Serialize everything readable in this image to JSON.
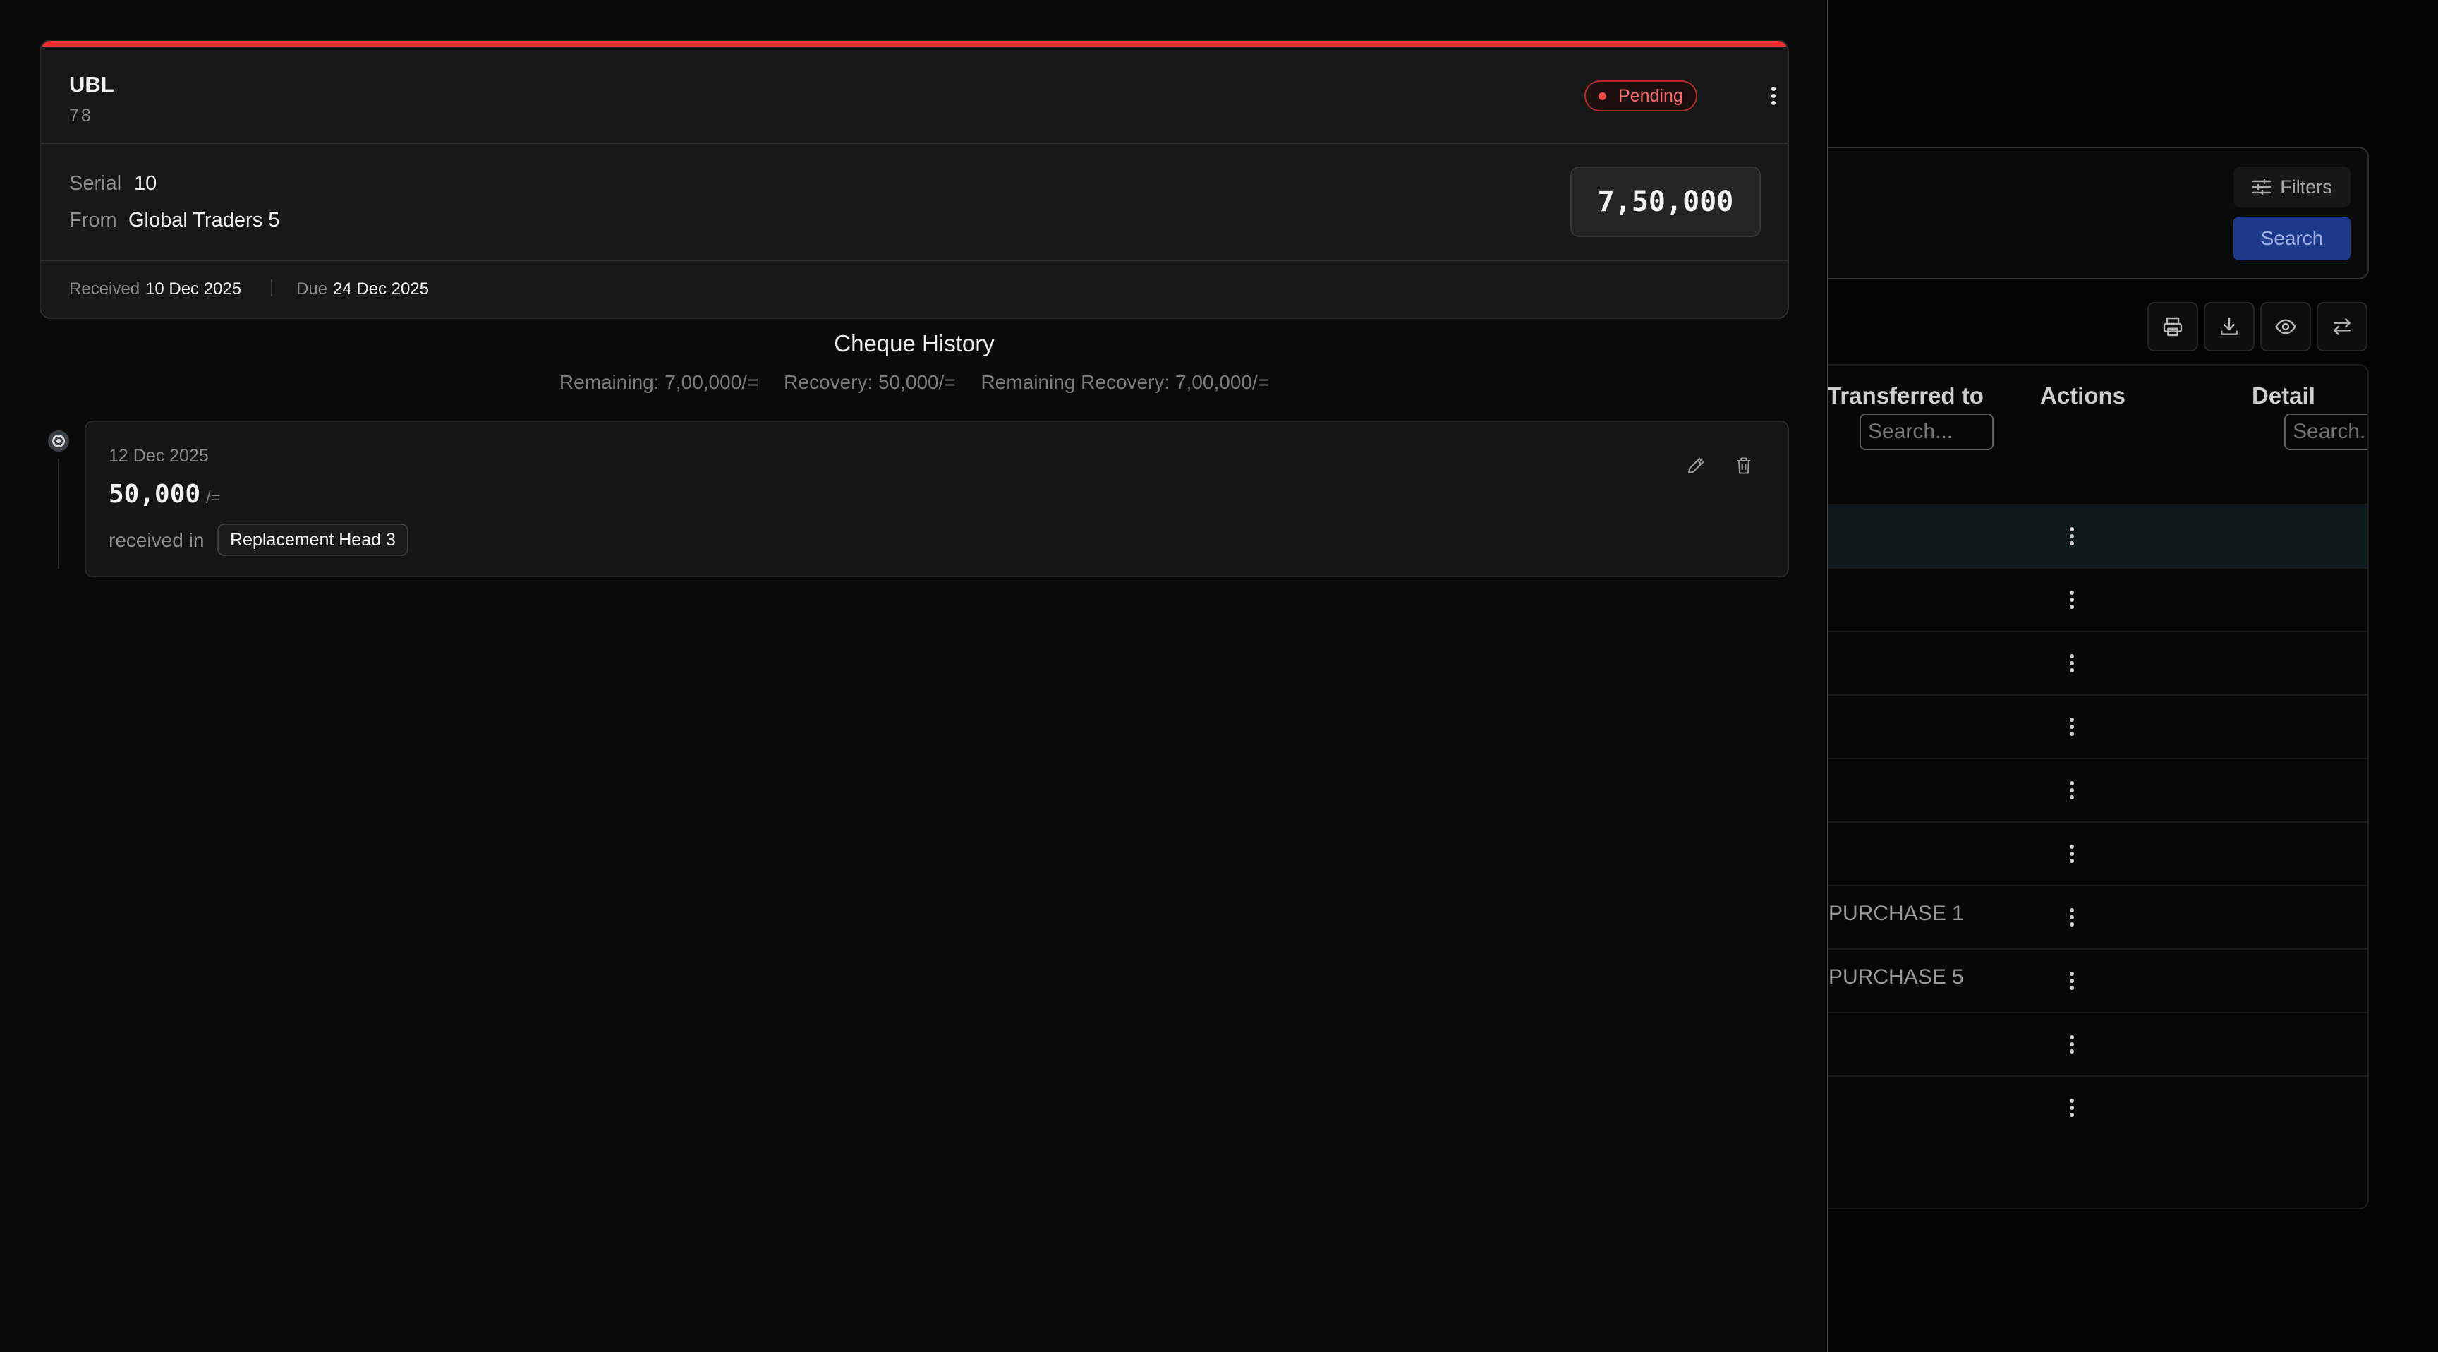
{
  "background": {
    "filters_label": "Filters",
    "search_button_label": "Search",
    "table": {
      "columns": [
        "Transferred to",
        "Actions",
        "Detail"
      ],
      "search_placeholder": "Search...",
      "rows": [
        {
          "transferred_to": ""
        },
        {
          "transferred_to": ""
        },
        {
          "transferred_to": ""
        },
        {
          "transferred_to": ""
        },
        {
          "transferred_to": ""
        },
        {
          "transferred_to": ""
        },
        {
          "transferred_to": "PURCHASE 1"
        },
        {
          "transferred_to": "PURCHASE 5"
        },
        {
          "transferred_to": ""
        },
        {
          "transferred_to": ""
        }
      ]
    }
  },
  "cheque": {
    "bank": "UBL",
    "bank_sub": "78",
    "status": "Pending",
    "serial_label": "Serial",
    "serial": "10",
    "from_label": "From",
    "from": "Global Traders 5",
    "amount": "7,50,000",
    "received_label": "Received",
    "received_date": "10 Dec 2025",
    "due_label": "Due",
    "due_date": "24 Dec 2025",
    "accent_color": "#e5312f"
  },
  "history": {
    "title": "Cheque History",
    "remaining": "Remaining: 7,00,000/=",
    "recovery": "Recovery: 50,000/=",
    "remaining_recovery": "Remaining Recovery: 7,00,000/=",
    "entries": [
      {
        "date": "12 Dec 2025",
        "amount": "50,000",
        "unit": "/=",
        "received_in_label": "received in",
        "account": "Replacement Head 3"
      }
    ]
  }
}
